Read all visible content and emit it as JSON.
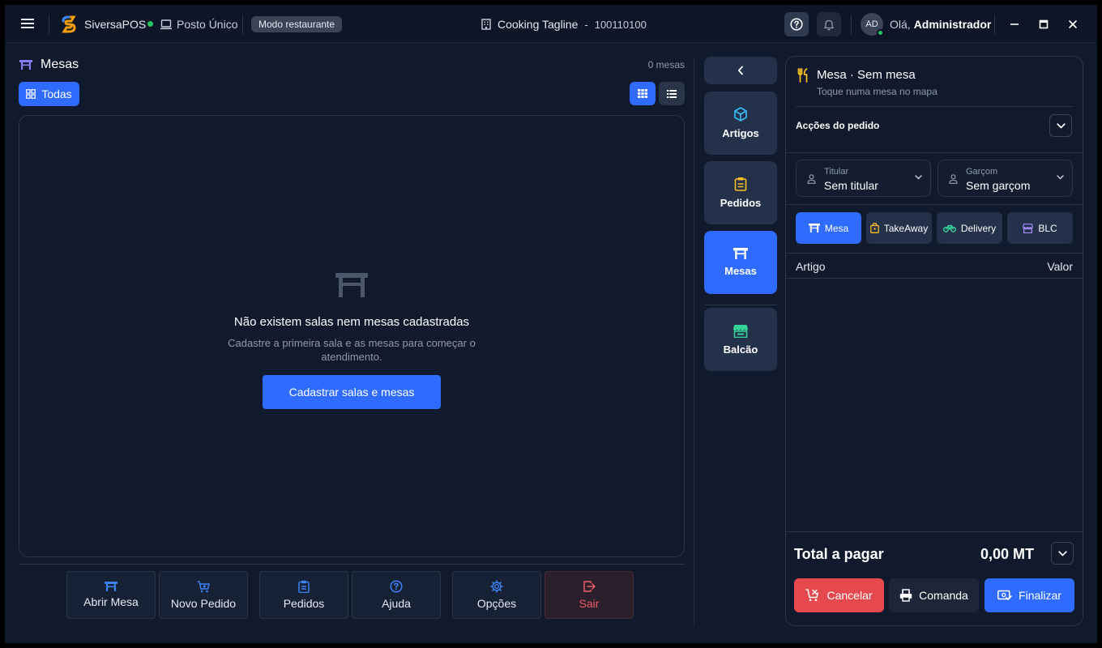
{
  "titlebar": {
    "brand": "SiversaPOS",
    "posto": "Posto Único",
    "mode_badge": "Modo restaurante",
    "company": "Cooking Tagline",
    "separator": "-",
    "nif": "100110100",
    "avatar_initials": "AD",
    "greeting_prefix": "Olá,",
    "user_name": "Administrador"
  },
  "left": {
    "title": "Mesas",
    "count": "0 mesas",
    "filter_label": "Todas",
    "empty_title": "Não existem salas nem mesas cadastradas",
    "empty_desc": "Cadastre a primeira sala e as mesas para começar o atendimento.",
    "cta": "Cadastrar salas e mesas"
  },
  "actions": [
    {
      "label": "Abrir Mesa",
      "icon": "table-icon"
    },
    {
      "label": "Novo Pedido",
      "icon": "cart-icon"
    },
    {
      "label": "Pedidos",
      "icon": "clipboard-icon"
    },
    {
      "label": "Ajuda",
      "icon": "help-icon"
    },
    {
      "label": "Opções",
      "icon": "gear-icon"
    },
    {
      "label": "Sair",
      "icon": "logout-icon"
    }
  ],
  "rail": [
    {
      "label": "Artigos",
      "icon": "box-icon"
    },
    {
      "label": "Pedidos",
      "icon": "clipboard-icon"
    },
    {
      "label": "Mesas",
      "icon": "table-icon"
    },
    {
      "label": "Balcão",
      "icon": "store-icon"
    }
  ],
  "order": {
    "title": "Mesa · Sem mesa",
    "subtitle": "Toque numa mesa no mapa",
    "actions_label": "Acções do pedido",
    "titular_label": "Titular",
    "titular_value": "Sem titular",
    "garcom_label": "Garçom",
    "garcom_value": "Sem garçom",
    "types": [
      "Mesa",
      "TakeAway",
      "Delivery",
      "BLC"
    ],
    "col_item": "Artigo",
    "col_value": "Valor",
    "total_label": "Total a pagar",
    "total_value": "0,00 MT",
    "btn_cancel": "Cancelar",
    "btn_comanda": "Comanda",
    "btn_finalizar": "Finalizar"
  },
  "colors": {
    "accent": "#2f6bff",
    "danger": "#e5484d",
    "online": "#22c55e",
    "background": "#111a2c"
  }
}
